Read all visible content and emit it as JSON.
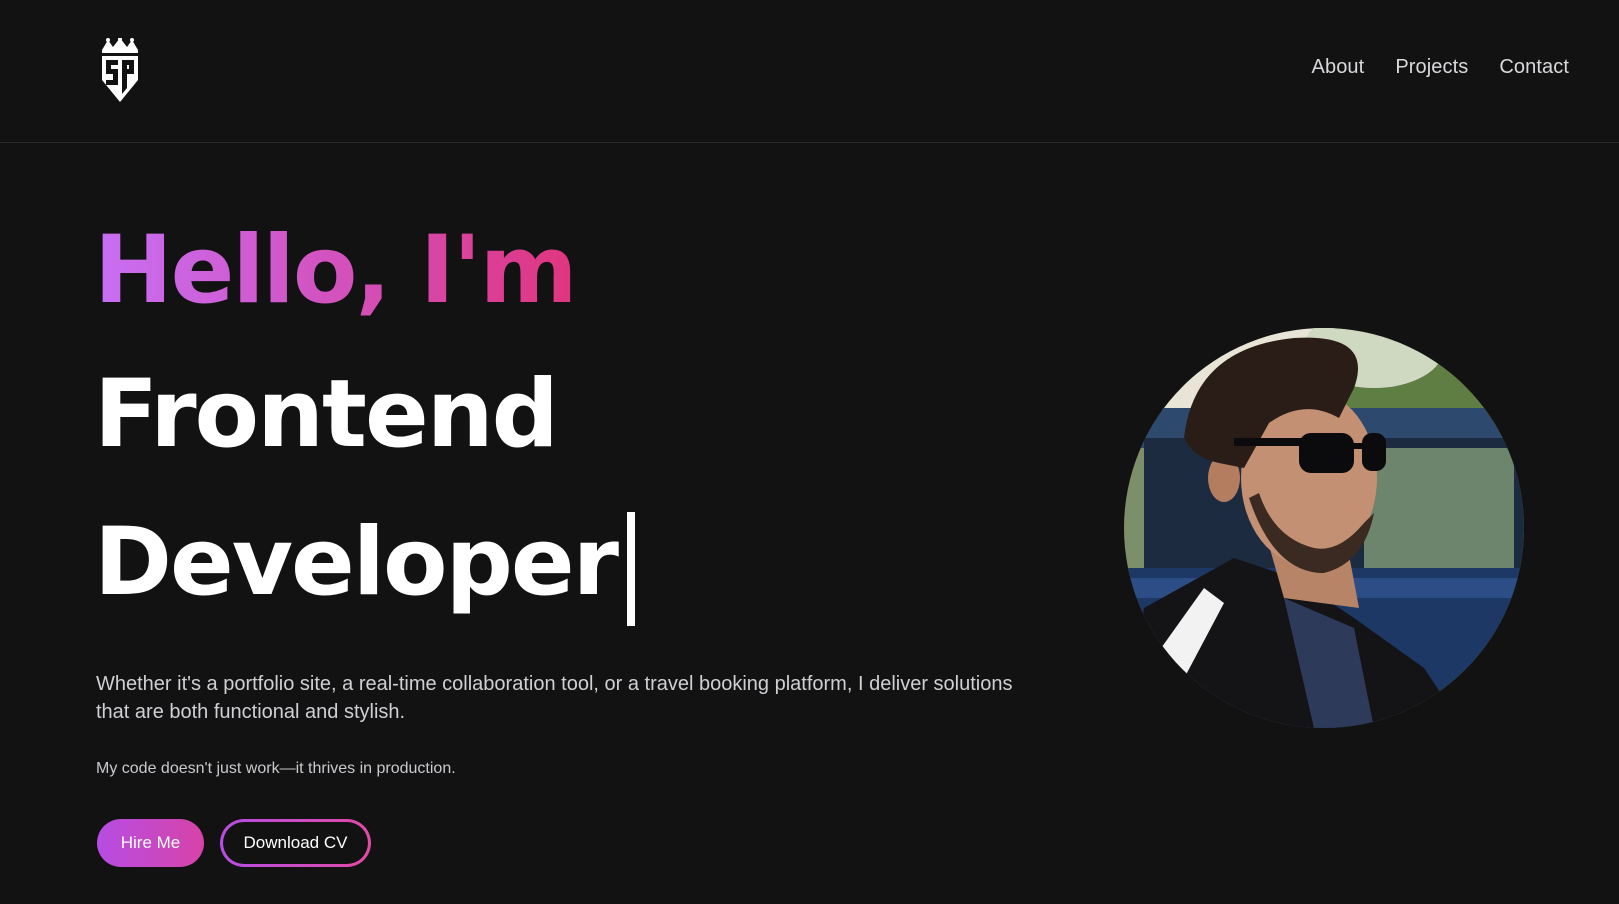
{
  "header": {
    "logo_icon": "sp-crown-logo-icon",
    "nav": [
      {
        "label": "About"
      },
      {
        "label": "Projects"
      },
      {
        "label": "Contact"
      }
    ]
  },
  "hero": {
    "greeting": "Hello, I'm",
    "role_line_1": "Frontend",
    "role_line_2": "Developer",
    "description": "Whether it's a portfolio site, a real-time collaboration tool, or a travel booking platform, I deliver solutions that are both functional and stylish.",
    "tagline": "My code doesn't just work—it thrives in production.",
    "primary_button": "Hire Me",
    "secondary_button": "Download CV"
  },
  "colors": {
    "background": "#131213",
    "gradient_start": "#c86ff5",
    "gradient_end": "#e0357e",
    "text_muted": "#cfcfd4"
  }
}
